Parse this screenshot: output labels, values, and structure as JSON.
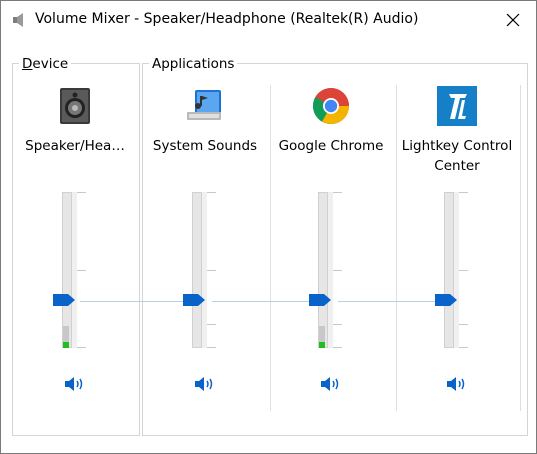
{
  "window": {
    "title": "Volume Mixer - Speaker/Headphone (Realtek(R) Audio)"
  },
  "device": {
    "group_label": "Device",
    "underline_char": "D",
    "rest": "evice",
    "channel": {
      "name": "Speaker/Hea…",
      "volume": 0.35,
      "peak": 0.04
    }
  },
  "applications": {
    "group_label": "Applications",
    "channels": [
      {
        "name": "System Sounds",
        "volume": 0.35,
        "peak": 0.0,
        "icon": "system-sounds-icon"
      },
      {
        "name": "Google Chrome",
        "volume": 0.35,
        "peak": 0.04,
        "icon": "chrome-icon"
      },
      {
        "name": "Lightkey Control Center",
        "volume": 0.35,
        "peak": 0.0,
        "icon": "lightkey-icon"
      }
    ]
  },
  "colors": {
    "accent": "#0a63c9",
    "peak": "#1fbf1f",
    "chrome_red": "#db4437",
    "chrome_yellow": "#f4b400",
    "chrome_green": "#0f9d58",
    "chrome_blue": "#4285f4",
    "lightkey": "#1580c8"
  }
}
